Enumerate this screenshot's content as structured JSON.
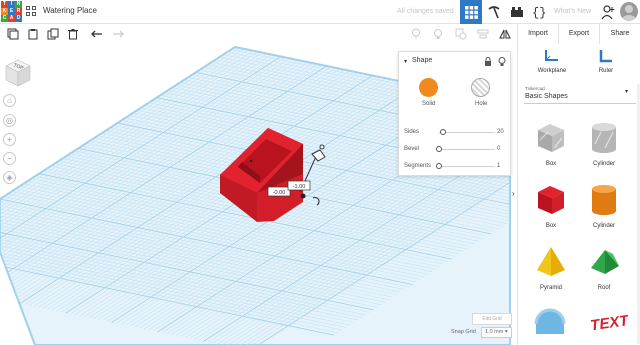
{
  "app": {
    "logo_letters": [
      "T",
      "I",
      "N",
      "K",
      "E",
      "R",
      "C",
      "A",
      "D"
    ],
    "logo_colors": [
      "#e2412c",
      "#2f78c4",
      "#35a848",
      "#f2891f",
      "#2f78c4",
      "#e2412c",
      "#35a848",
      "#e2412c",
      "#2f78c4"
    ],
    "design_title": "Watering Place",
    "save_status": "All changes saved",
    "whats_new": "What's New"
  },
  "right_header": {
    "import": "Import",
    "export": "Export",
    "share": "Share"
  },
  "viewcube": {
    "face_label": "TOP"
  },
  "shape_panel": {
    "title": "Shape",
    "solid_label": "Solid",
    "hole_label": "Hole",
    "solid_color": "#f2891f",
    "params": [
      {
        "label": "Sides",
        "value": "20",
        "fraction": 0.07
      },
      {
        "label": "Bevel",
        "value": "0",
        "fraction": 0.0
      },
      {
        "label": "Segments",
        "value": "1",
        "fraction": 0.0
      }
    ]
  },
  "workspace": {
    "dim_left": "-0.00",
    "dim_right": "-1.00",
    "edit_grid": "Edit Grid",
    "snap_grid_label": "Snap Grid",
    "snap_grid_value": "1.0 mm",
    "object_color": "#e2232f"
  },
  "sidebar": {
    "workplane_label": "Workplane",
    "ruler_label": "Ruler",
    "library_small": "Tinkercad",
    "library_value": "Basic Shapes",
    "shapes": [
      {
        "name": "Box",
        "kind": "box-gray"
      },
      {
        "name": "Cylinder",
        "kind": "cyl-gray"
      },
      {
        "name": "Box",
        "kind": "box-red"
      },
      {
        "name": "Cylinder",
        "kind": "cyl-orange"
      },
      {
        "name": "Pyramid",
        "kind": "pyramid"
      },
      {
        "name": "Roof",
        "kind": "roof"
      }
    ]
  }
}
